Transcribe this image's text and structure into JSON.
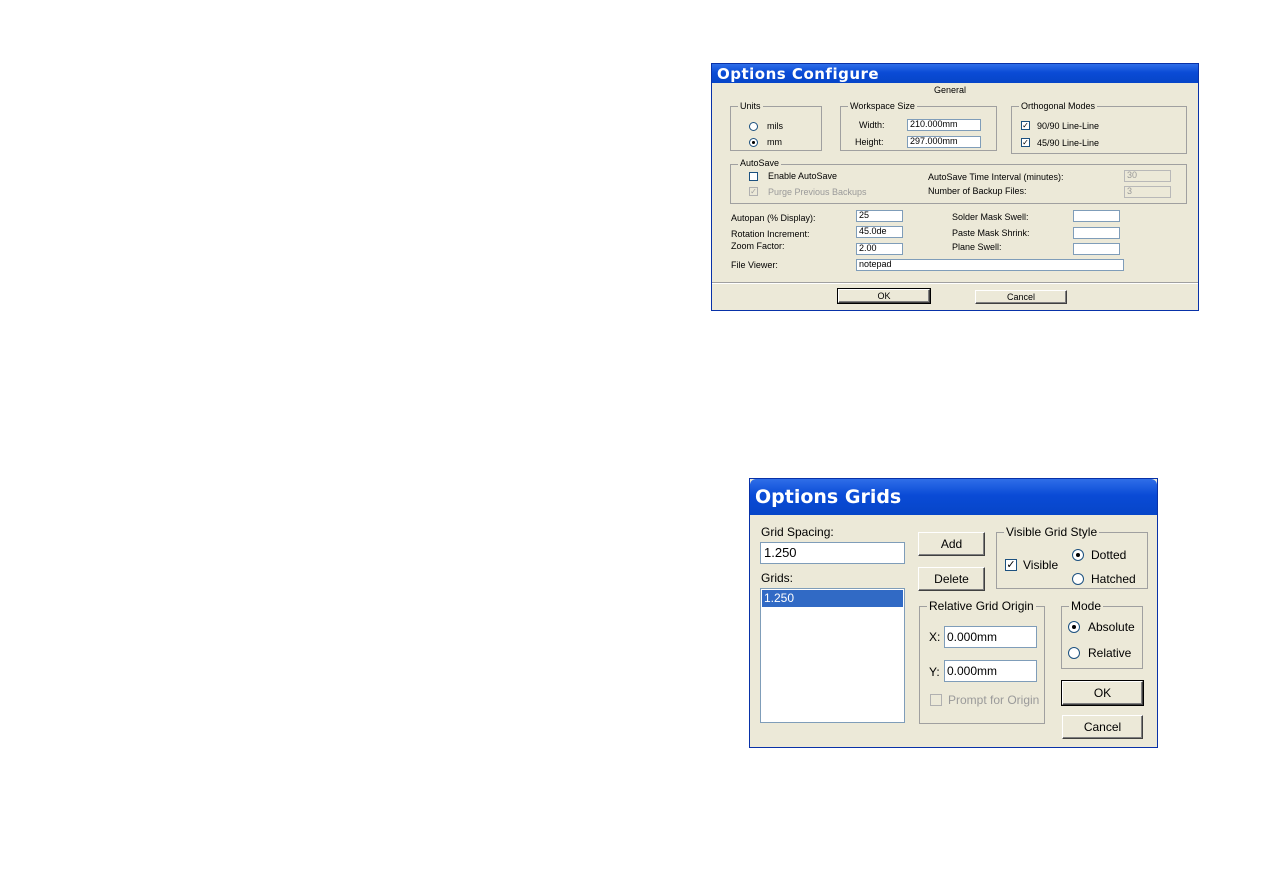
{
  "configure": {
    "title": "Options Configure",
    "general_caption": "General",
    "units": {
      "caption": "Units",
      "options": [
        "mils",
        "mm"
      ],
      "selected": "mm"
    },
    "workspace": {
      "caption": "Workspace Size",
      "width_label": "Width:",
      "width_value": "210.000mm",
      "height_label": "Height:",
      "height_value": "297.000mm"
    },
    "ortho": {
      "caption": "Orthogonal Modes",
      "items": [
        {
          "label": "90/90  Line-Line",
          "checked": true
        },
        {
          "label": "45/90  Line-Line",
          "checked": true
        }
      ]
    },
    "autosave": {
      "caption": "AutoSave",
      "enable_label": "Enable AutoSave",
      "enable_checked": false,
      "purge_label": "Purge Previous Backups",
      "purge_checked": true,
      "interval_label": "AutoSave Time Interval (minutes):",
      "interval_value": "30",
      "backups_label": "Number of Backup Files:",
      "backups_value": "3"
    },
    "autopan_label": "Autopan (% Display):",
    "autopan_value": "25",
    "rotation_label": "Rotation Increment:",
    "rotation_value": "45.0de",
    "zoom_label": "Zoom Factor:",
    "zoom_value": "2.00",
    "fileviewer_label": "File Viewer:",
    "fileviewer_value": "notepad",
    "solder_label": "Solder Mask Swell:",
    "solder_value": "",
    "paste_label": "Paste Mask Shrink:",
    "paste_value": "",
    "plane_label": "Plane Swell:",
    "plane_value": "",
    "ok_label": "OK",
    "cancel_label": "Cancel"
  },
  "grids": {
    "title": "Options Grids",
    "spacing_label": "Grid Spacing:",
    "spacing_value": "1.250",
    "grids_label": "Grids:",
    "grids_items": [
      "1.250"
    ],
    "add_label": "Add",
    "delete_label": "Delete",
    "visible_style": {
      "caption": "Visible Grid Style",
      "visible_label": "Visible",
      "visible_checked": true,
      "options": [
        "Dotted",
        "Hatched"
      ],
      "selected": "Dotted"
    },
    "origin": {
      "caption": "Relative Grid Origin",
      "x_label": "X:",
      "x_value": "0.000mm",
      "y_label": "Y:",
      "y_value": "0.000mm",
      "prompt_label": "Prompt for Origin",
      "prompt_checked": false
    },
    "mode": {
      "caption": "Mode",
      "options": [
        "Absolute",
        "Relative"
      ],
      "selected": "Absolute"
    },
    "ok_label": "OK",
    "cancel_label": "Cancel"
  },
  "colors": {
    "title_blue": "#0a4bd6",
    "dialog_face": "#ece9d8",
    "selection": "#316ac5"
  }
}
